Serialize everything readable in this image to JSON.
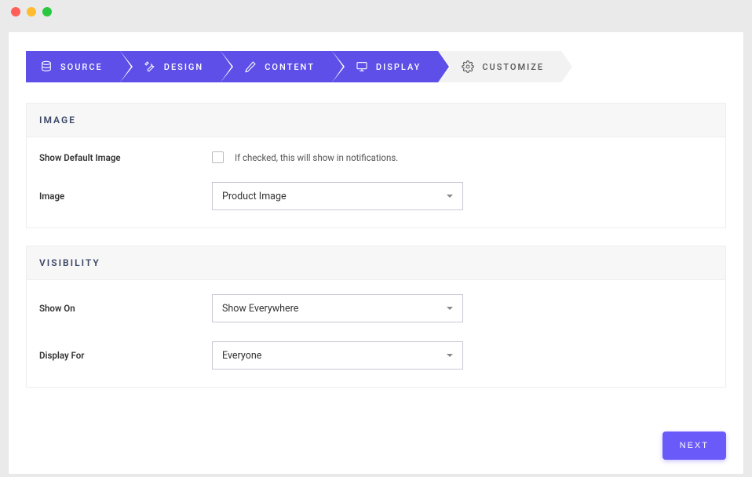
{
  "wizard": {
    "steps": [
      {
        "label": "SOURCE",
        "active": true
      },
      {
        "label": "DESIGN",
        "active": true
      },
      {
        "label": "CONTENT",
        "active": true
      },
      {
        "label": "DISPLAY",
        "active": true
      },
      {
        "label": "CUSTOMIZE",
        "active": false
      }
    ]
  },
  "sections": {
    "image": {
      "title": "IMAGE",
      "show_default_image_label": "Show Default Image",
      "show_default_image_help": "If checked, this will show in notifications.",
      "show_default_image_checked": false,
      "image_label": "Image",
      "image_value": "Product Image"
    },
    "visibility": {
      "title": "VISIBILITY",
      "show_on_label": "Show On",
      "show_on_value": "Show Everywhere",
      "display_for_label": "Display For",
      "display_for_value": "Everyone"
    }
  },
  "buttons": {
    "next": "NEXT"
  }
}
